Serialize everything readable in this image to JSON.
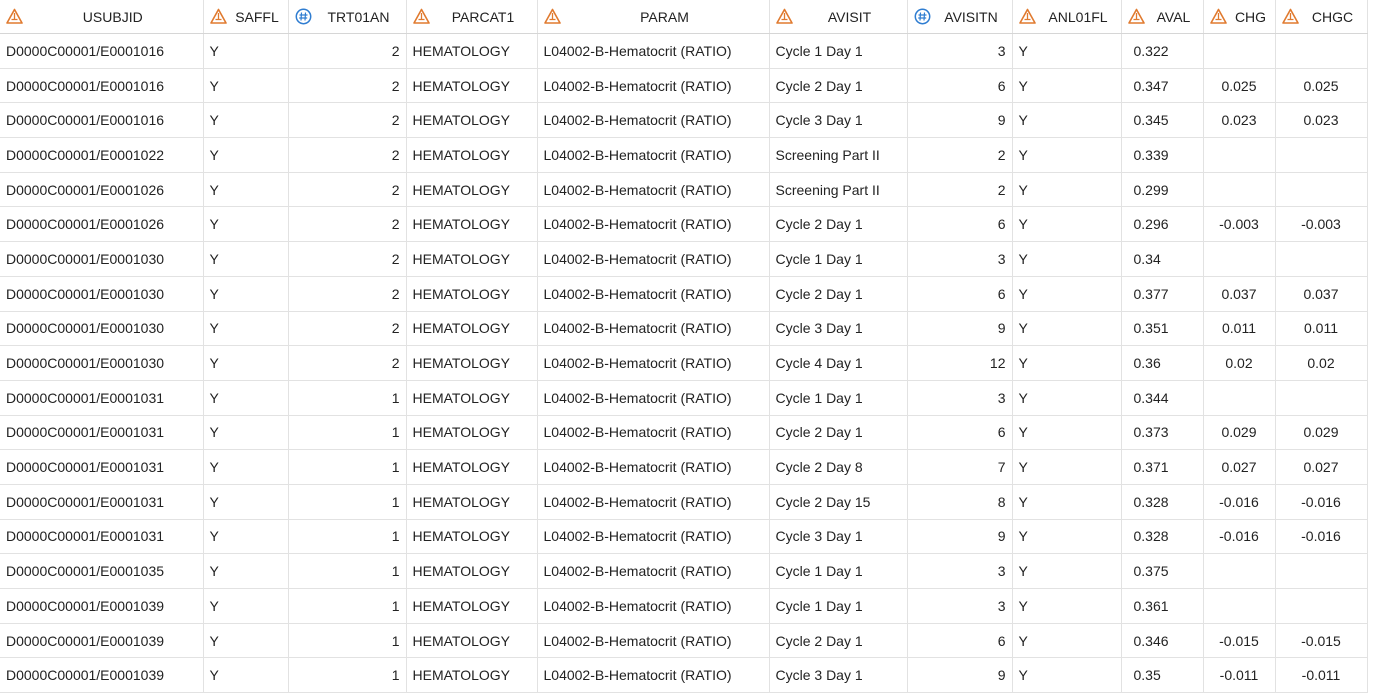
{
  "colors": {
    "char_icon": "#e07a2f",
    "num_icon": "#2f7dd1",
    "grid_line": "#e2e2e2"
  },
  "columns": [
    {
      "key": "USUBJID",
      "label": "USUBJID",
      "type": "char",
      "icon": "character-column-icon"
    },
    {
      "key": "SAFFL",
      "label": "SAFFL",
      "type": "char",
      "icon": "character-column-icon"
    },
    {
      "key": "TRT01AN",
      "label": "TRT01AN",
      "type": "num",
      "icon": "numeric-column-icon"
    },
    {
      "key": "PARCAT1",
      "label": "PARCAT1",
      "type": "char",
      "icon": "character-column-icon"
    },
    {
      "key": "PARAM",
      "label": "PARAM",
      "type": "char",
      "icon": "character-column-icon"
    },
    {
      "key": "AVISIT",
      "label": "AVISIT",
      "type": "char",
      "icon": "character-column-icon"
    },
    {
      "key": "AVISITN",
      "label": "AVISITN",
      "type": "num",
      "icon": "numeric-column-icon"
    },
    {
      "key": "ANL01FL",
      "label": "ANL01FL",
      "type": "char",
      "icon": "character-column-icon"
    },
    {
      "key": "AVAL",
      "label": "AVAL",
      "type": "char",
      "icon": "character-column-icon"
    },
    {
      "key": "CHG",
      "label": "CHG",
      "type": "char",
      "icon": "character-column-icon"
    },
    {
      "key": "CHGC",
      "label": "CHGC",
      "type": "char",
      "icon": "character-column-icon"
    }
  ],
  "rows": [
    [
      "D0000C00001/E0001016",
      "Y",
      "2",
      "HEMATOLOGY",
      "L04002-B-Hematocrit (RATIO)",
      "Cycle 1 Day 1",
      "3",
      "Y",
      "0.322",
      "",
      ""
    ],
    [
      "D0000C00001/E0001016",
      "Y",
      "2",
      "HEMATOLOGY",
      "L04002-B-Hematocrit (RATIO)",
      "Cycle 2 Day 1",
      "6",
      "Y",
      "0.347",
      "0.025",
      "0.025"
    ],
    [
      "D0000C00001/E0001016",
      "Y",
      "2",
      "HEMATOLOGY",
      "L04002-B-Hematocrit (RATIO)",
      "Cycle 3 Day 1",
      "9",
      "Y",
      "0.345",
      "0.023",
      "0.023"
    ],
    [
      "D0000C00001/E0001022",
      "Y",
      "2",
      "HEMATOLOGY",
      "L04002-B-Hematocrit (RATIO)",
      "Screening Part II",
      "2",
      "Y",
      "0.339",
      "",
      ""
    ],
    [
      "D0000C00001/E0001026",
      "Y",
      "2",
      "HEMATOLOGY",
      "L04002-B-Hematocrit (RATIO)",
      "Screening Part II",
      "2",
      "Y",
      "0.299",
      "",
      ""
    ],
    [
      "D0000C00001/E0001026",
      "Y",
      "2",
      "HEMATOLOGY",
      "L04002-B-Hematocrit (RATIO)",
      "Cycle 2 Day 1",
      "6",
      "Y",
      "0.296",
      "-0.003",
      "-0.003"
    ],
    [
      "D0000C00001/E0001030",
      "Y",
      "2",
      "HEMATOLOGY",
      "L04002-B-Hematocrit (RATIO)",
      "Cycle 1 Day 1",
      "3",
      "Y",
      "0.34",
      "",
      ""
    ],
    [
      "D0000C00001/E0001030",
      "Y",
      "2",
      "HEMATOLOGY",
      "L04002-B-Hematocrit (RATIO)",
      "Cycle 2 Day 1",
      "6",
      "Y",
      "0.377",
      "0.037",
      "0.037"
    ],
    [
      "D0000C00001/E0001030",
      "Y",
      "2",
      "HEMATOLOGY",
      "L04002-B-Hematocrit (RATIO)",
      "Cycle 3 Day 1",
      "9",
      "Y",
      "0.351",
      "0.011",
      "0.011"
    ],
    [
      "D0000C00001/E0001030",
      "Y",
      "2",
      "HEMATOLOGY",
      "L04002-B-Hematocrit (RATIO)",
      "Cycle 4 Day 1",
      "12",
      "Y",
      "0.36",
      "0.02",
      "0.02"
    ],
    [
      "D0000C00001/E0001031",
      "Y",
      "1",
      "HEMATOLOGY",
      "L04002-B-Hematocrit (RATIO)",
      "Cycle 1 Day 1",
      "3",
      "Y",
      "0.344",
      "",
      ""
    ],
    [
      "D0000C00001/E0001031",
      "Y",
      "1",
      "HEMATOLOGY",
      "L04002-B-Hematocrit (RATIO)",
      "Cycle 2 Day 1",
      "6",
      "Y",
      "0.373",
      "0.029",
      "0.029"
    ],
    [
      "D0000C00001/E0001031",
      "Y",
      "1",
      "HEMATOLOGY",
      "L04002-B-Hematocrit (RATIO)",
      "Cycle 2 Day 8",
      "7",
      "Y",
      "0.371",
      "0.027",
      "0.027"
    ],
    [
      "D0000C00001/E0001031",
      "Y",
      "1",
      "HEMATOLOGY",
      "L04002-B-Hematocrit (RATIO)",
      "Cycle 2 Day 15",
      "8",
      "Y",
      "0.328",
      "-0.016",
      "-0.016"
    ],
    [
      "D0000C00001/E0001031",
      "Y",
      "1",
      "HEMATOLOGY",
      "L04002-B-Hematocrit (RATIO)",
      "Cycle 3 Day 1",
      "9",
      "Y",
      "0.328",
      "-0.016",
      "-0.016"
    ],
    [
      "D0000C00001/E0001035",
      "Y",
      "1",
      "HEMATOLOGY",
      "L04002-B-Hematocrit (RATIO)",
      "Cycle 1 Day 1",
      "3",
      "Y",
      "0.375",
      "",
      ""
    ],
    [
      "D0000C00001/E0001039",
      "Y",
      "1",
      "HEMATOLOGY",
      "L04002-B-Hematocrit (RATIO)",
      "Cycle 1 Day 1",
      "3",
      "Y",
      "0.361",
      "",
      ""
    ],
    [
      "D0000C00001/E0001039",
      "Y",
      "1",
      "HEMATOLOGY",
      "L04002-B-Hematocrit (RATIO)",
      "Cycle 2 Day 1",
      "6",
      "Y",
      "0.346",
      "-0.015",
      "-0.015"
    ],
    [
      "D0000C00001/E0001039",
      "Y",
      "1",
      "HEMATOLOGY",
      "L04002-B-Hematocrit (RATIO)",
      "Cycle 3 Day 1",
      "9",
      "Y",
      "0.35",
      "-0.011",
      "-0.011"
    ]
  ]
}
